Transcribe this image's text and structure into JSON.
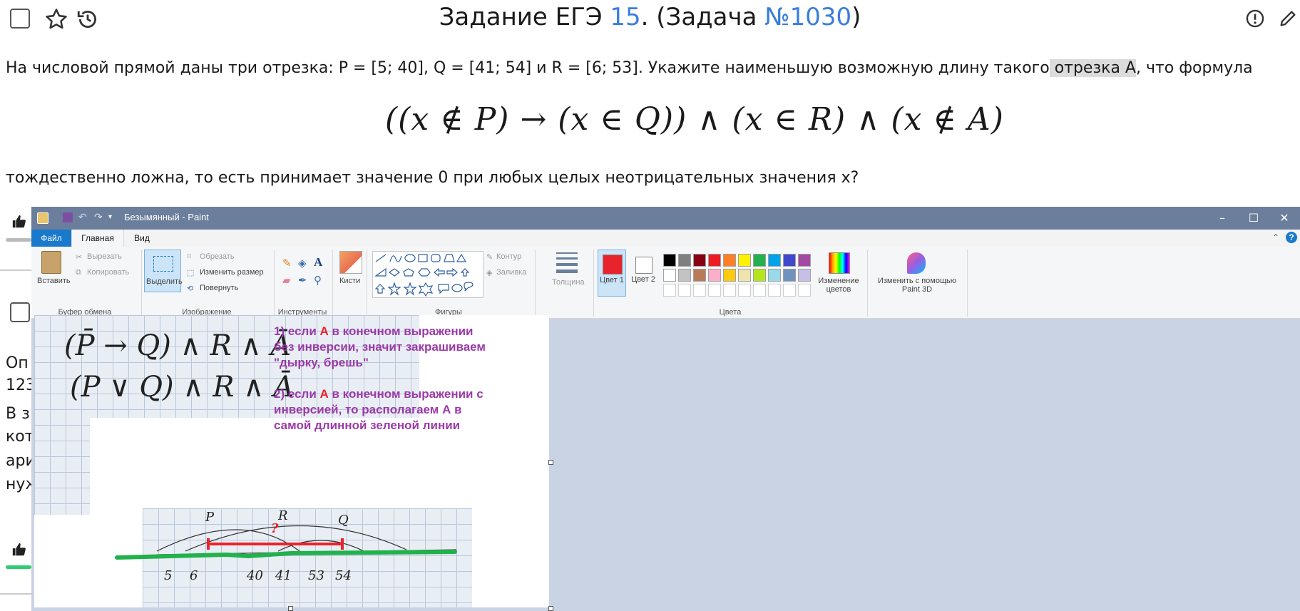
{
  "header": {
    "title_prefix": "Задание ЕГЭ ",
    "task_number": "15",
    "title_middle": ". (Задача ",
    "problem_id": "№1030",
    "title_suffix": ")"
  },
  "problem": {
    "line1_a": "На числовой прямой даны три отрезка: P = [5; 40], Q = [41; 54] и R = [6; 53]. Укажите наименьшую возможную длину такого",
    "line1_hl": " отрезка A",
    "line1_b": ", что формула",
    "formula": "((x ∉ P) → (x ∈ Q)) ∧ (x ∈ R) ∧ (x ∉ A)",
    "line2": "тождественно ложна, то есть принимает значение 0 при любых целых неотрицательных значения x?"
  },
  "background_fragments": [
    "Оп",
    "123",
    "В з",
    "кот",
    "ари",
    "нуж"
  ],
  "paint": {
    "window_title": "Безымянный - Paint",
    "tabs": [
      "Файл",
      "Главная",
      "Вид"
    ],
    "clipboard": {
      "paste": "Вставить",
      "cut": "Вырезать",
      "copy": "Копировать",
      "group": "Буфер обмена"
    },
    "image": {
      "select": "Выделить",
      "crop": "Обрезать",
      "resize": "Изменить размер",
      "rotate": "Повернуть",
      "group": "Изображение"
    },
    "tools": {
      "group": "Инструменты"
    },
    "brushes": "Кисти",
    "shapes": {
      "outline": "Контур",
      "fill": "Заливка",
      "group": "Фигуры"
    },
    "size": "Толщина",
    "color1_label": "Цвет 1",
    "color2_label": "Цвет 2",
    "edit_colors": "Изменение цветов",
    "paint3d": "Изменить с помощью Paint 3D",
    "colors_group": "Цвета",
    "color1": "#e8232b",
    "color2": "#ffffff",
    "palette_row1": [
      "#000000",
      "#7f7f7f",
      "#880015",
      "#ed1c24",
      "#ff7f27",
      "#fff200",
      "#22b14c",
      "#00a2e8",
      "#3f48cc",
      "#a349a4"
    ],
    "palette_row2": [
      "#ffffff",
      "#c3c3c3",
      "#b97a57",
      "#ffaec9",
      "#ffc90e",
      "#efe4b0",
      "#b5e61d",
      "#99d9ea",
      "#7092be",
      "#c8bfe7"
    ]
  },
  "notes": {
    "n1_pre": "1) если ",
    "n1_a": "А",
    "n1_post": " в конечном выражении",
    "n1_l2": "без инверсии, значит закрашиваем",
    "n1_l3": "\"дырку, брешь\"",
    "n2_pre": "2) если ",
    "n2_a": "А",
    "n2_post": " в конечном выражении с",
    "n2_l2": "инверсией, то располагаем А в",
    "n2_l3": "самой длинной зеленой линии"
  },
  "handwriting": {
    "expr1": "(P̄ → Q) ∧ R ∧ Ā",
    "expr2": "(P ∨ Q) ∧ R ∧ Ā",
    "labels_top": [
      "P",
      "R",
      "Q"
    ],
    "numbers": [
      "5",
      "6",
      "40",
      "41",
      "53",
      "54"
    ],
    "question": "?"
  }
}
